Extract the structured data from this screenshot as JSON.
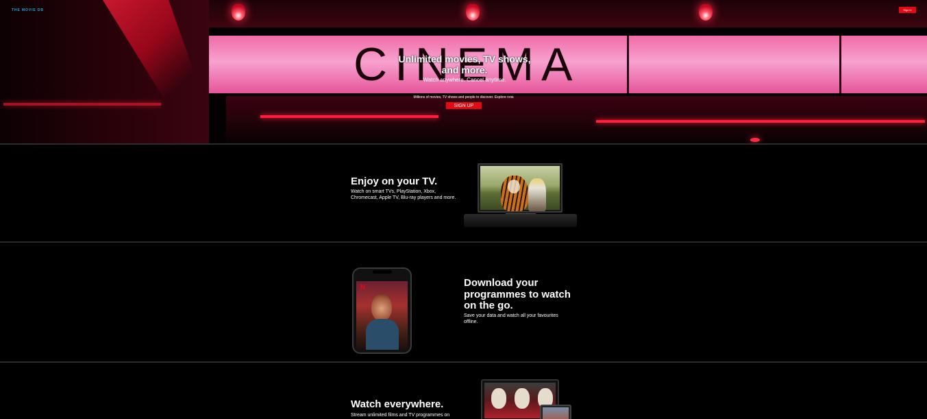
{
  "header": {
    "logo_text": "THE MOVIE DB",
    "signin_label": "Sign in"
  },
  "hero": {
    "marquee_word": "CINEMA",
    "title": "Unlimited movies, TV shows, and more.",
    "subtitle": "Watch anywhere. Cancel anytime.",
    "description": "Millions of movies, TV shows and people to discover. Explore now.",
    "signup_label": "SIGN UP"
  },
  "stories": [
    {
      "title": "Enjoy on your TV.",
      "text": "Watch on smart TVs, PlayStation, Xbox, Chromecast, Apple TV, Blu-ray players and more."
    },
    {
      "title": "Download your programmes to watch on the go.",
      "text": "Save your data and watch all your favourites offline."
    },
    {
      "title": "Watch everywhere.",
      "text": "Stream unlimited films and TV programmes on"
    }
  ],
  "colors": {
    "accent": "#e50914",
    "logo": "#29a8d6",
    "divider": "#2b2b2b"
  }
}
